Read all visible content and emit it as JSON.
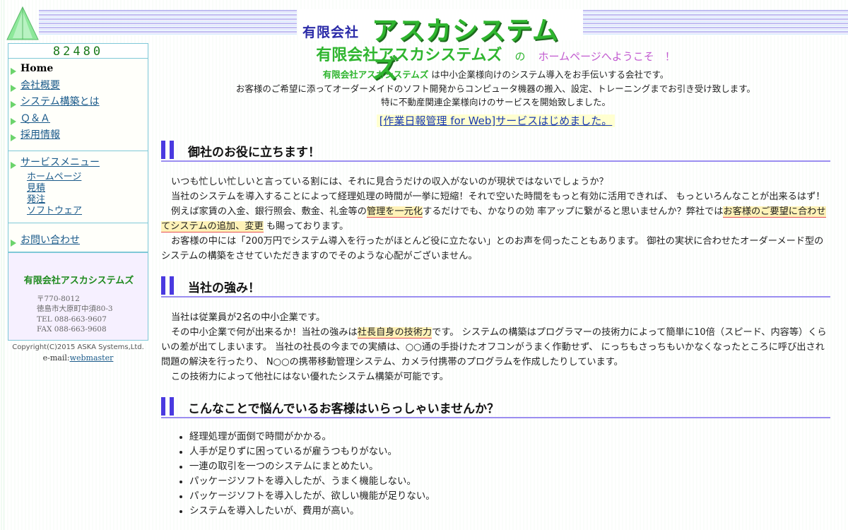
{
  "header": {
    "logo_small": "有限会社",
    "logo_big": "アスカシステムズ"
  },
  "sidebar": {
    "counter": "82480",
    "nav": [
      {
        "label": "Home"
      },
      {
        "label": "会社概要"
      },
      {
        "label": "システム構築とは"
      },
      {
        "label": "Ｑ＆Ａ"
      },
      {
        "label": "採用情報"
      }
    ],
    "services_label": "サービスメニュー",
    "services": [
      {
        "label": "ホームページ"
      },
      {
        "label": "見積"
      },
      {
        "label": "発注"
      },
      {
        "label": "ソフトウェア"
      }
    ],
    "contact_label": "お問い合わせ",
    "company": {
      "name": "有限会社アスカシステムズ",
      "postal": "〒770-8012",
      "address": "徳島市大原町中須80-3",
      "tel": "TEL 088-663-9607",
      "fax": "FAX 088-663-9608"
    },
    "copyright": "Copyright(C)2015 ASKA Systems,Ltd.",
    "email_prefix": "e-mail:",
    "email_link": "webmaster"
  },
  "main": {
    "welcome_company": "有限会社アスカシステムズ",
    "welcome_no": "の",
    "welcome_text": "ホームページへようこそ　！",
    "intro_company": "有限会社アスカシステムズ",
    "intro_line1_rest": " は中小企業様向けのシステム導入をお手伝いする会社です。",
    "intro_line2": "お客様のご希望に添ってオーダーメイドのソフト開発からコンピュータ機器の搬入、設定、トレーニングまでお引き受け致します。",
    "intro_line3": "特に不動産関連企業様向けのサービスを開始致しました。",
    "news_link": "[作業日報管理 for Web]サービスはじめました。",
    "section1": {
      "title": "御社のお役に立ちます！",
      "p1": "いつも忙しい忙しいと言っている割には、それに見合うだけの収入がないのが現状ではないでしょうか？",
      "p2": "当社のシステムを導入することによって経理処理の時間が一挙に短縮！それで空いた時間をもっと有効に活用できれば、 もっといろんなことが出来るはず！",
      "p3a": "例えば家賃の入金、銀行照会、敷金、礼金等の",
      "p3b": "管理を一元化",
      "p3c": "するだけでも、かなりの効 率アップに繋がると思いませんか？弊社では",
      "p3d": "お客様のご要望に合わせてシステムの追加、変更",
      "p3e": " も賜っております。",
      "p4": "お客様の中には「200万円でシステム導入を行ったがほとんど役に立たない」とのお声を伺ったこともあります。 御社の実状に合わせたオーダーメード型のシステムの構築をさせていただきますのでそのような心配がございません。"
    },
    "section2": {
      "title": "当社の強み！",
      "p1": "当社は従業員が2名の中小企業です。",
      "p2a": "その中小企業で何が出来るか！当社の強みは",
      "p2b": "社長自身の技術力",
      "p2c": "です。 システムの構築はプログラマーの技術力によって簡単に10倍（スピード、内容等）くらいの差が出てしまいます。 当社の社長の今までの実績は、○○通の手掛けたオフコンがうまく作動せず、 にっちもさっちもいかなくなったところに呼び出され問題の解決を行ったり、 N○○の携帯移動管理システム、カメラ付携帯のプログラムを作成したりしています。",
      "p3": "この技術力によって他社にはない優れたシステム構築が可能です。"
    },
    "section3": {
      "title": "こんなことで悩んでいるお客様はいらっしゃいませんか？",
      "items": [
        "経理処理が面倒で時間がかかる。",
        "人手が足りずに困っているが雇うつもりがない。",
        "一連の取引を一つのシステムにまとめたい。",
        "パッケージソフトを導入したが、うまく機能しない。",
        "パッケージソフトを導入したが、欲しい機能が足りない。",
        "システムを導入したいが、費用が高い。"
      ]
    }
  }
}
